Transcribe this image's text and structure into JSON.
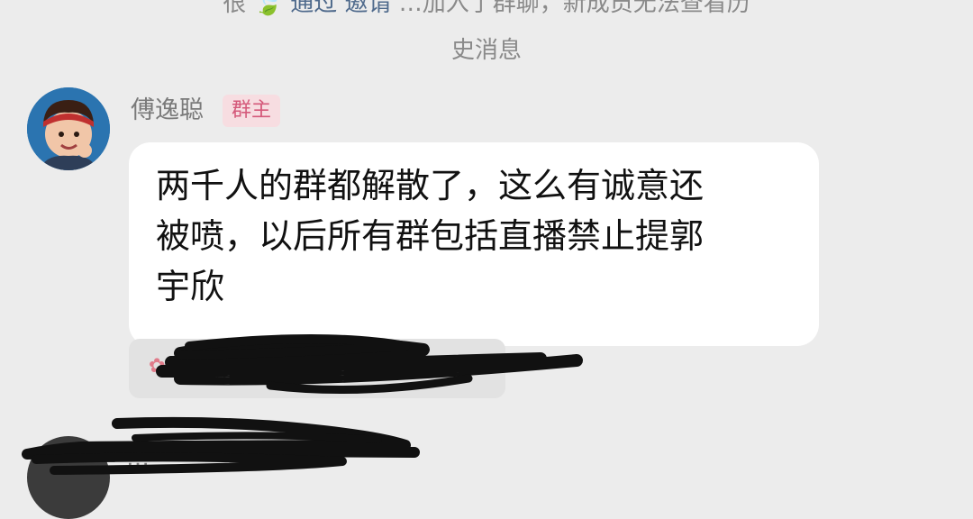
{
  "system_notice": {
    "line1_prefix": "很",
    "line1_icon": "leaf",
    "line1_link": "通过 邀请",
    "line1_suffix": "…加入了群聊，新成员无法查看历",
    "line2": "史消息"
  },
  "message": {
    "sender_name": "傅逸聪",
    "sender_badge": "群主",
    "avatar_icon": "girl-avatar",
    "lines": [
      "两千人的群都解散了，这么有诚意还",
      "被喷，以后所有群包括直播禁止提郭",
      "宇欣"
    ]
  },
  "quote_card": {
    "icon": "flower-icon",
    "text": "…载图…"
  },
  "next_message": {
    "sender_name": "…"
  },
  "colors": {
    "background": "#ececec",
    "bubble": "#ffffff",
    "badge_bg": "#f7dde1",
    "badge_text": "#d4597a",
    "redaction": "#111111"
  }
}
